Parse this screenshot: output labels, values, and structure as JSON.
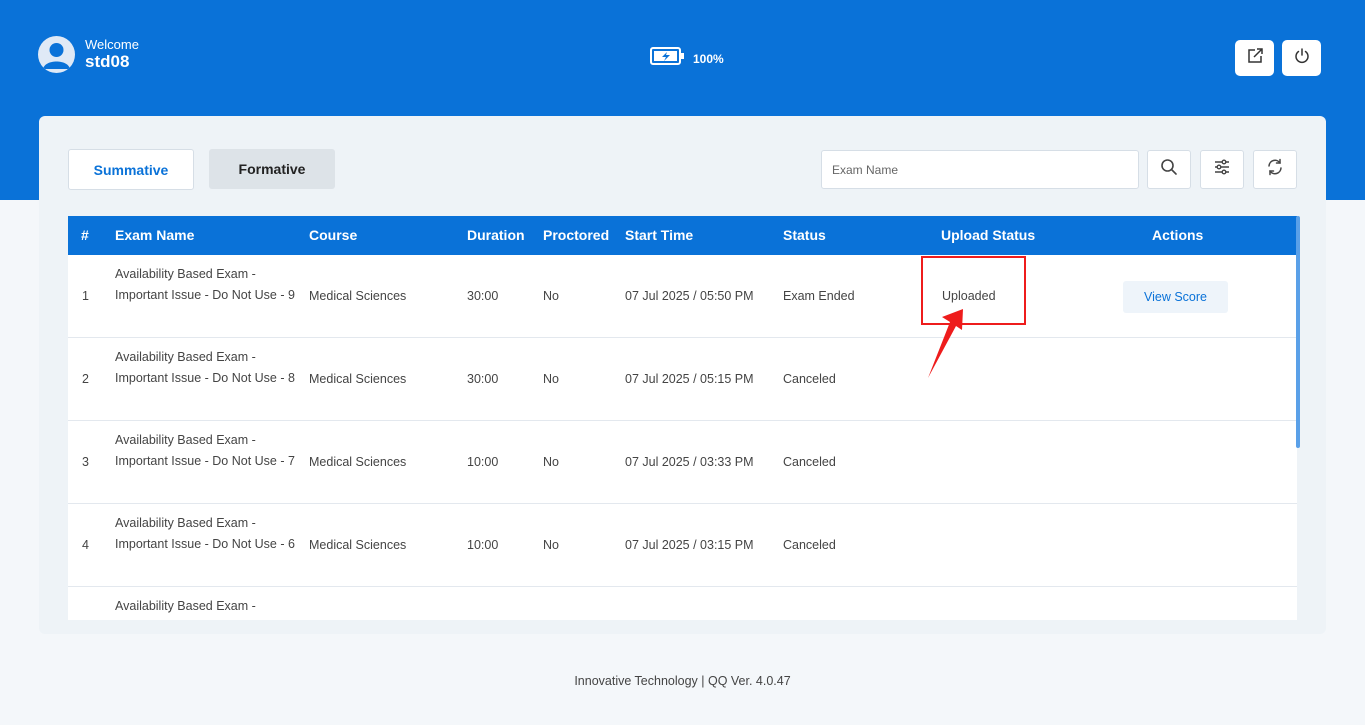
{
  "header": {
    "welcome_label": "Welcome",
    "username": "std08",
    "battery_level": "100%",
    "icons": {
      "avatar": "user-avatar-icon",
      "battery": "battery-charging-icon",
      "open_external": "external-link-icon",
      "power": "power-icon"
    }
  },
  "tabs": [
    {
      "label": "Summative",
      "active": true
    },
    {
      "label": "Formative",
      "active": false
    }
  ],
  "search": {
    "placeholder": "Exam Name",
    "value": ""
  },
  "toolbar_icons": [
    "search-icon",
    "filter-sliders-icon",
    "refresh-icon"
  ],
  "table": {
    "columns": [
      "#",
      "Exam Name",
      "Course",
      "Duration",
      "Proctored",
      "Start Time",
      "Status",
      "Upload Status",
      "Actions"
    ],
    "rows": [
      {
        "num": "1",
        "name": "Availability Based Exam - Important Issue - Do Not Use - 9",
        "course": "Medical Sciences",
        "duration": "30:00",
        "proctored": "No",
        "start": "07 Jul 2025 / 05:50 PM",
        "status": "Exam Ended",
        "upload": "Uploaded",
        "action": "View Score"
      },
      {
        "num": "2",
        "name": "Availability Based Exam - Important Issue - Do Not Use - 8",
        "course": "Medical Sciences",
        "duration": "30:00",
        "proctored": "No",
        "start": "07 Jul 2025 / 05:15 PM",
        "status": "Canceled",
        "upload": "",
        "action": ""
      },
      {
        "num": "3",
        "name": "Availability Based Exam - Important Issue - Do Not Use - 7",
        "course": "Medical Sciences",
        "duration": "10:00",
        "proctored": "No",
        "start": "07 Jul 2025 / 03:33 PM",
        "status": "Canceled",
        "upload": "",
        "action": ""
      },
      {
        "num": "4",
        "name": "Availability Based Exam - Important Issue - Do Not Use - 6",
        "course": "Medical Sciences",
        "duration": "10:00",
        "proctored": "No",
        "start": "07 Jul 2025 / 03:15 PM",
        "status": "Canceled",
        "upload": "",
        "action": ""
      },
      {
        "num": "",
        "name": "Availability Based Exam -",
        "course": "",
        "duration": "",
        "proctored": "",
        "start": "",
        "status": "",
        "upload": "",
        "action": ""
      }
    ]
  },
  "annotation": {
    "color": "#ee1c1c"
  },
  "footer": {
    "text": "Innovative Technology | QQ Ver. 4.0.47"
  },
  "colors": {
    "primary": "#0a72d8",
    "background": "#f4f7fa"
  }
}
